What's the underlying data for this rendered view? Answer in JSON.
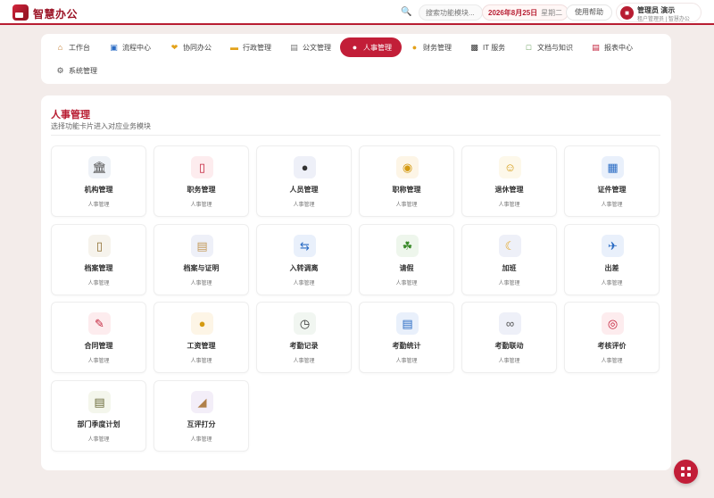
{
  "header": {
    "brand": "智慧办公",
    "search_placeholder": "搜索功能模块...",
    "date": "2026年8月25日",
    "weekday": "星期二",
    "help_label": "使用帮助",
    "user_name": "管理员 演示",
    "user_role": "租户管理员 | 智慧办公",
    "accent_color": "#b81d32"
  },
  "nav": {
    "items": [
      {
        "label": "工作台",
        "icon": "home-icon"
      },
      {
        "label": "流程中心",
        "icon": "flow-icon"
      },
      {
        "label": "协同办公",
        "icon": "handshake-icon"
      },
      {
        "label": "行政管理",
        "icon": "folder-icon"
      },
      {
        "label": "公文管理",
        "icon": "document-icon"
      },
      {
        "label": "人事管理",
        "icon": "people-icon",
        "active": true
      },
      {
        "label": "财务管理",
        "icon": "money-bag-icon"
      },
      {
        "label": "IT 服务",
        "icon": "computer-icon"
      },
      {
        "label": "文档与知识",
        "icon": "book-icon"
      },
      {
        "label": "报表中心",
        "icon": "chart-icon"
      },
      {
        "label": "系统管理",
        "icon": "gear-icon"
      }
    ]
  },
  "main": {
    "title": "人事管理",
    "subtitle": "选择功能卡片进入对应业务模块",
    "cards": [
      {
        "name": "机构管理",
        "sub": "人事管理",
        "icon": "building-icon"
      },
      {
        "name": "职务管理",
        "sub": "人事管理",
        "icon": "badge-icon"
      },
      {
        "name": "人员管理",
        "sub": "人事管理",
        "icon": "people-icon"
      },
      {
        "name": "职称管理",
        "sub": "人事管理",
        "icon": "medal-icon"
      },
      {
        "name": "退休管理",
        "sub": "人事管理",
        "icon": "elder-icon"
      },
      {
        "name": "证件管理",
        "sub": "人事管理",
        "icon": "id-card-icon"
      },
      {
        "name": "档案管理",
        "sub": "人事管理",
        "icon": "archive-icon"
      },
      {
        "name": "档案与证明",
        "sub": "人事管理",
        "icon": "scroll-icon"
      },
      {
        "name": "入转调离",
        "sub": "人事管理",
        "icon": "transfer-icon"
      },
      {
        "name": "请假",
        "sub": "人事管理",
        "icon": "palm-tree-icon"
      },
      {
        "name": "加班",
        "sub": "人事管理",
        "icon": "moon-icon"
      },
      {
        "name": "出差",
        "sub": "人事管理",
        "icon": "airplane-icon"
      },
      {
        "name": "合同管理",
        "sub": "人事管理",
        "icon": "contract-icon"
      },
      {
        "name": "工资管理",
        "sub": "人事管理",
        "icon": "coin-bag-icon"
      },
      {
        "name": "考勤记录",
        "sub": "人事管理",
        "icon": "clock-icon"
      },
      {
        "name": "考勤统计",
        "sub": "人事管理",
        "icon": "bar-chart-icon"
      },
      {
        "name": "考勤联动",
        "sub": "人事管理",
        "icon": "link-icon"
      },
      {
        "name": "考核评价",
        "sub": "人事管理",
        "icon": "target-icon"
      },
      {
        "name": "部门季度计划",
        "sub": "人事管理",
        "icon": "clipboard-icon"
      },
      {
        "name": "互评打分",
        "sub": "人事管理",
        "icon": "box-icon"
      }
    ]
  }
}
